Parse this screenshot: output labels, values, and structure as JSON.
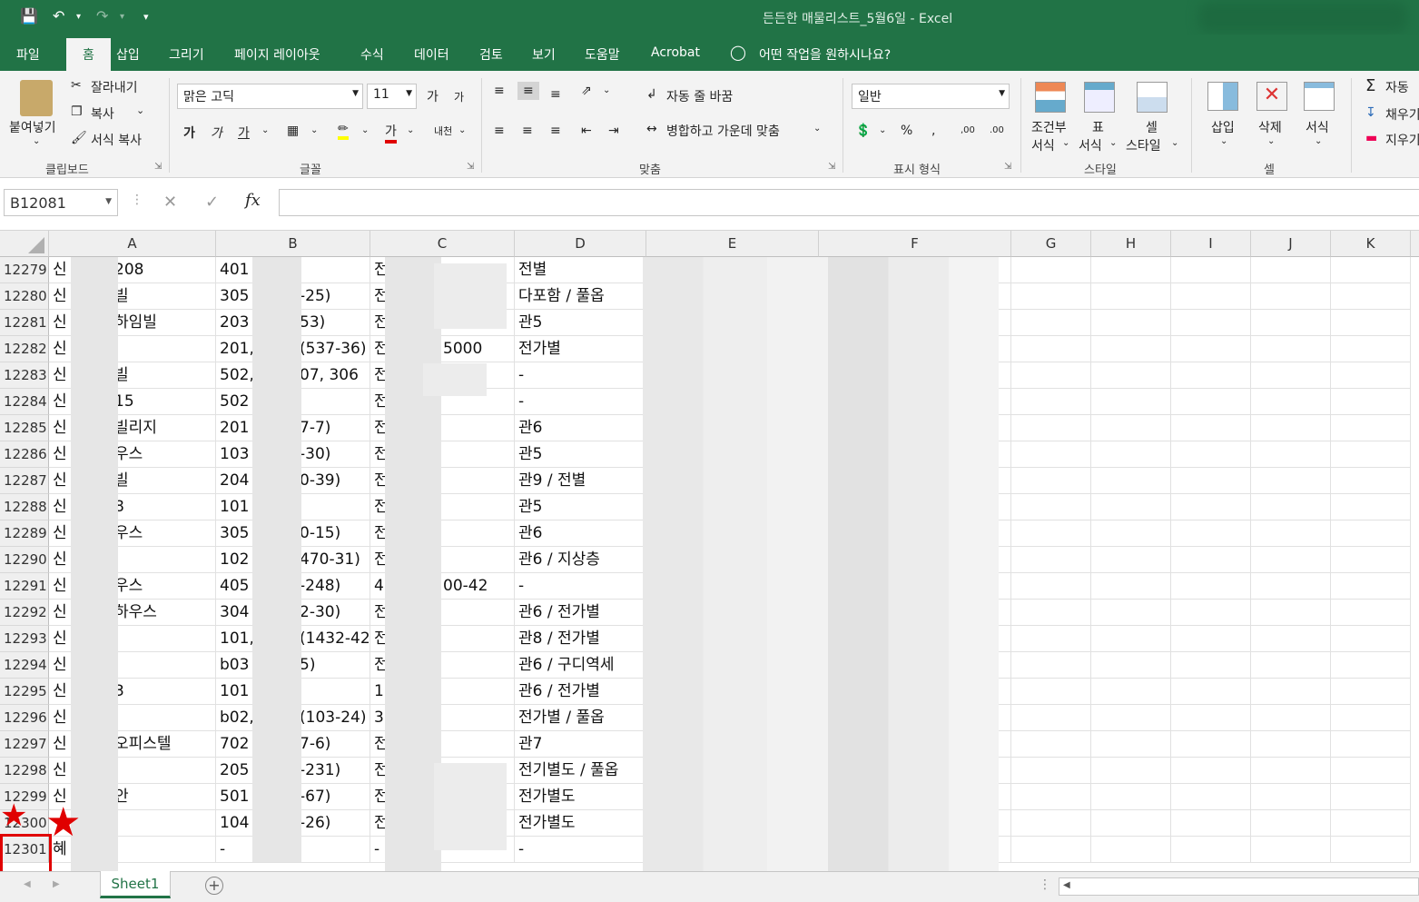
{
  "window": {
    "title": "든든한 매물리스트_5월6일  -  Excel"
  },
  "tabs": [
    "파일",
    "홈",
    "삽입",
    "그리기",
    "페이지 레이아웃",
    "수식",
    "데이터",
    "검토",
    "보기",
    "도움말",
    "Acrobat"
  ],
  "active_tab": "홈",
  "tell_me": "어떤 작업을 원하시나요?",
  "ribbon": {
    "clipboard": {
      "paste": "붙여넣기",
      "cut": "잘라내기",
      "copy": "복사",
      "format_painter": "서식 복사",
      "group": "클립보드"
    },
    "font": {
      "name": "맑은 고딕",
      "size": "11",
      "group": "글꼴",
      "grow": "가",
      "shrink": "가",
      "bold": "가",
      "italic": "가",
      "underline": "가",
      "color": "가",
      "phonetic": "내천"
    },
    "alignment": {
      "wrap": "자동 줄 바꿈",
      "merge": "병합하고 가운데 맞춤",
      "group": "맞춤"
    },
    "number": {
      "format": "일반",
      "percent": "%",
      "inc_dec": ",00",
      "dec_dec": ".00",
      "group": "표시 형식"
    },
    "styles": {
      "conditional": "조건부",
      "conditional2": "서식",
      "table": "표",
      "table2": "서식",
      "cell_style": "셀",
      "cell_style2": "스타일",
      "group": "스타일"
    },
    "cells": {
      "insert": "삽입",
      "delete": "삭제",
      "format": "서식",
      "group": "셀"
    },
    "editing": {
      "autosum": "자동",
      "fill": "채우기",
      "clear": "지우기"
    }
  },
  "formula_bar": {
    "name_box": "B12081",
    "fx": "fx",
    "content": ""
  },
  "columns": [
    "A",
    "B",
    "C",
    "D",
    "E",
    "F",
    "G",
    "H",
    "I",
    "J",
    "K"
  ],
  "rows": [
    {
      "num": "12279",
      "a": "신",
      "a2": "208",
      "b": "401",
      "b2": "",
      "c": "전",
      "c2": "",
      "d": "전별"
    },
    {
      "num": "12280",
      "a": "신",
      "a2": "빌",
      "b": "305",
      "b2": "-25)",
      "c": "전",
      "c2": "",
      "d": "다포함 / 풀옵"
    },
    {
      "num": "12281",
      "a": "신",
      "a2": "하임빌",
      "b": "203",
      "b2": "53)",
      "c": "전",
      "c2": "",
      "d": "관5"
    },
    {
      "num": "12282",
      "a": "신",
      "a2": "",
      "b": "201,",
      "b2": "(537-36)",
      "c": "전",
      "c2": "5000",
      "d": "전가별"
    },
    {
      "num": "12283",
      "a": "신",
      "a2": "빌",
      "b": "502,",
      "b2": "07, 306",
      "c": "전",
      "c2": "",
      "d": "-"
    },
    {
      "num": "12284",
      "a": "신",
      "a2": "15",
      "b": "502",
      "b2": "",
      "c": "전",
      "c2": "",
      "d": "-"
    },
    {
      "num": "12285",
      "a": "신",
      "a2": "빌리지",
      "b": "201",
      "b2": "7-7)",
      "c": "전",
      "c2": "",
      "d": "관6"
    },
    {
      "num": "12286",
      "a": "신",
      "a2": "우스",
      "b": "103",
      "b2": "-30)",
      "c": "전",
      "c2": "",
      "d": "관5"
    },
    {
      "num": "12287",
      "a": "신",
      "a2": "빌",
      "b": "204",
      "b2": "0-39)",
      "c": "전",
      "c2": "",
      "d": "관9 / 전별"
    },
    {
      "num": "12288",
      "a": "신",
      "a2": "8",
      "b": "101",
      "b2": "",
      "c": "전",
      "c2": "",
      "d": "관5"
    },
    {
      "num": "12289",
      "a": "신",
      "a2": "우스",
      "b": "305",
      "b2": "0-15)",
      "c": "전",
      "c2": "",
      "d": "관6"
    },
    {
      "num": "12290",
      "a": "신",
      "a2": "",
      "b": "102",
      "b2": "470-31)",
      "c": "전",
      "c2": "",
      "d": "관6 / 지상층"
    },
    {
      "num": "12291",
      "a": "신",
      "a2": "우스",
      "b": "405",
      "b2": "-248)",
      "c": "4",
      "c2": "00-42",
      "d": "-"
    },
    {
      "num": "12292",
      "a": "신",
      "a2": "하우스",
      "b": "304",
      "b2": "2-30)",
      "c": "전",
      "c2": "",
      "d": "관6 / 전가별"
    },
    {
      "num": "12293",
      "a": "신",
      "a2": "",
      "b": "101,",
      "b2": "(1432-42",
      "c": "전",
      "c2": "",
      "d": "관8 / 전가별"
    },
    {
      "num": "12294",
      "a": "신",
      "a2": "",
      "b": "b03",
      "b2": "5)",
      "c": "전",
      "c2": "",
      "d": "관6 / 구디역세"
    },
    {
      "num": "12295",
      "a": "신",
      "a2": "3",
      "b": "101",
      "b2": "",
      "c": "1",
      "c2": "",
      "d": "관6 / 전가별"
    },
    {
      "num": "12296",
      "a": "신",
      "a2": "",
      "b": "b02,",
      "b2": "(103-24)",
      "c": "3",
      "c2": "",
      "d": "전가별 / 풀옵"
    },
    {
      "num": "12297",
      "a": "신",
      "a2": "오피스텔",
      "b": "702",
      "b2": "7-6)",
      "c": "전",
      "c2": "",
      "d": "관7"
    },
    {
      "num": "12298",
      "a": "신",
      "a2": "",
      "b": "205",
      "b2": "-231)",
      "c": "전",
      "c2": "",
      "d": "전기별도 / 풀옵"
    },
    {
      "num": "12299",
      "a": "신",
      "a2": "안",
      "b": "501",
      "b2": "-67)",
      "c": "전",
      "c2": "",
      "d": "전가별도"
    },
    {
      "num": "12300",
      "a": "",
      "a2": "",
      "b": "104",
      "b2": "-26)",
      "c": "전",
      "c2": "",
      "d": "전가별도"
    },
    {
      "num": "12301",
      "a": "혜",
      "a2": "",
      "b": "-",
      "b2": "",
      "c": "-",
      "c2": "",
      "d": "-"
    }
  ],
  "sheet": {
    "name": "Sheet1",
    "add": "+"
  },
  "colors": {
    "excel_green": "#217346",
    "highlight": "#e00000"
  }
}
